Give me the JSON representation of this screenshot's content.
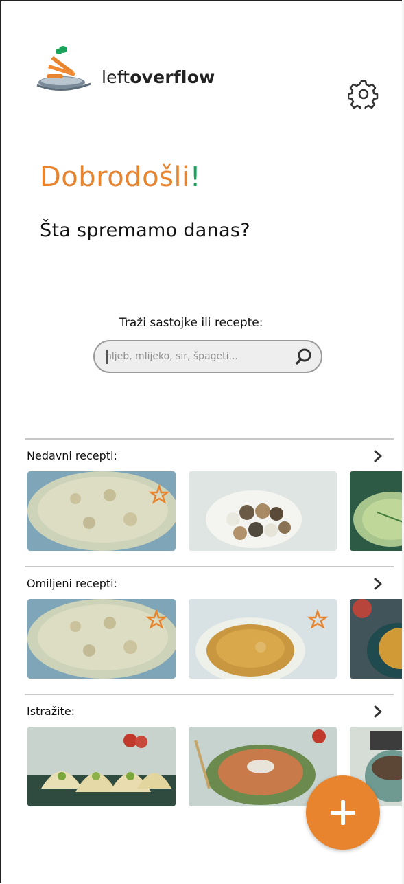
{
  "app": {
    "logo_light": "left",
    "logo_bold": "overflow"
  },
  "greeting": {
    "word": "Dobrodošli",
    "mark": "!",
    "question": "Šta spremamo danas?"
  },
  "search": {
    "label": "Traži sastojke ili recepte:",
    "placeholder": "hljeb, mlijeko, sir, špageti..."
  },
  "sections": [
    {
      "title": "Nedavni recepti:",
      "cards": [
        {
          "favorite": true
        },
        {
          "favorite": false
        },
        {
          "favorite": false
        }
      ]
    },
    {
      "title": "Omiljeni recepti:",
      "cards": [
        {
          "favorite": true
        },
        {
          "favorite": true
        },
        {
          "favorite": false
        }
      ]
    },
    {
      "title": "Istražite:",
      "cards": [
        {
          "favorite": false
        },
        {
          "favorite": false
        },
        {
          "favorite": false
        }
      ]
    }
  ],
  "icons": {
    "settings": "gear-icon",
    "search": "search-icon",
    "more": "chevron-right-icon",
    "favorite": "star-icon",
    "add": "plus-icon"
  },
  "colors": {
    "accent": "#e8832e",
    "green": "#1aa35b",
    "text": "#111111"
  }
}
